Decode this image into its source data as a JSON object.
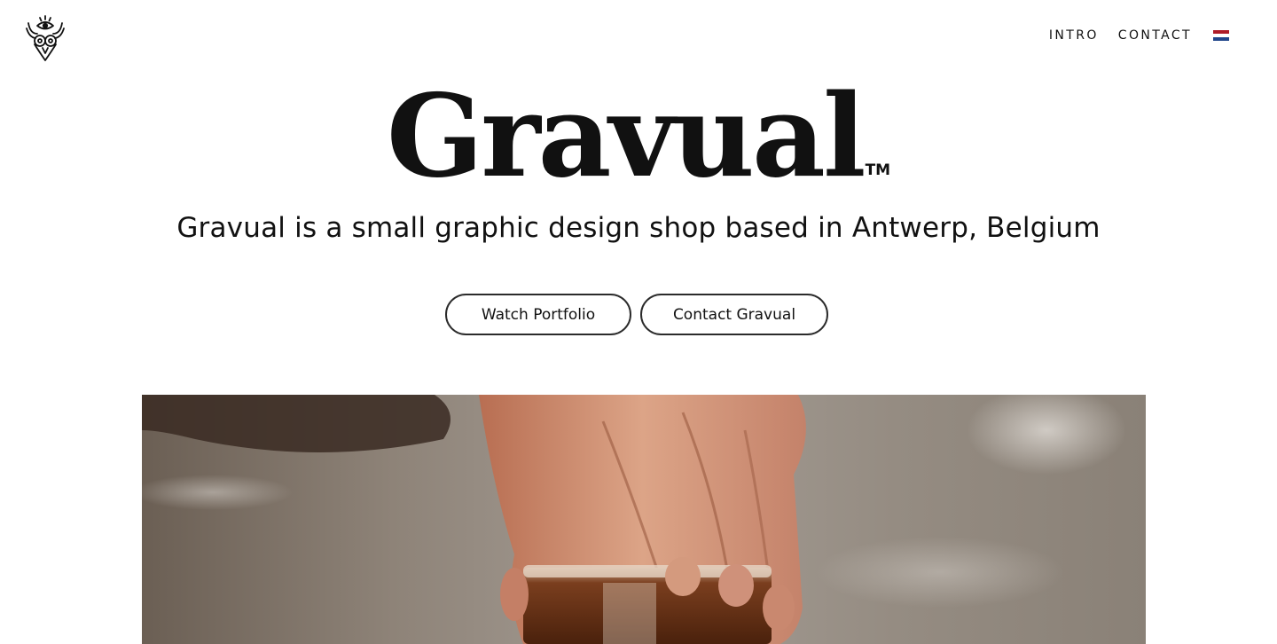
{
  "header": {
    "logo_name": "owl-logo",
    "nav": [
      {
        "label": "INTRO"
      },
      {
        "label": "CONTACT"
      }
    ],
    "language_flag": "netherlands-flag-icon"
  },
  "hero": {
    "brand": "Gravual",
    "trademark": "TM",
    "tagline": "Gravual is a small graphic design shop based in Antwerp, Belgium",
    "buttons": {
      "portfolio": "Watch Portfolio",
      "contact": "Contact Gravual"
    }
  },
  "photo": {
    "subject": "hand-holding-glass-photo"
  },
  "colors": {
    "text": "#111111",
    "background": "#ffffff",
    "button_border": "#2b2b2b",
    "flag_red": "#ae1c28",
    "flag_white": "#ffffff",
    "flag_blue": "#21468b"
  }
}
